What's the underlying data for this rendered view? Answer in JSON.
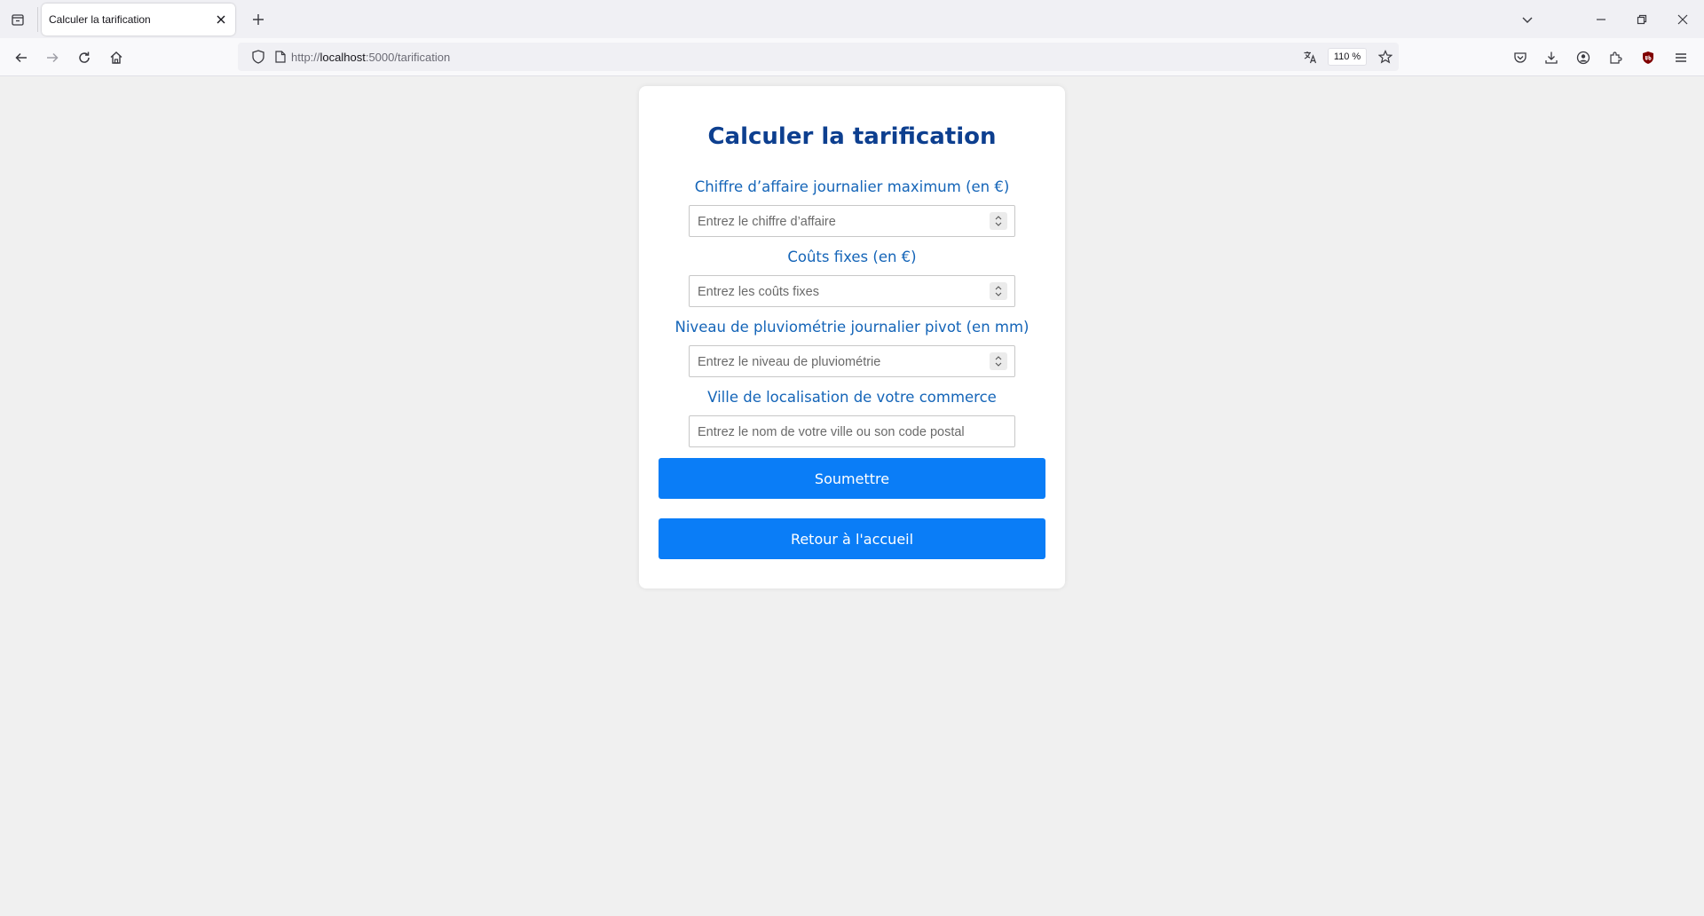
{
  "browser": {
    "tab_title": "Calculer la tarification",
    "url_scheme": "http://",
    "url_host": "localhost",
    "url_rest": ":5000/tarification",
    "zoom": "110 %"
  },
  "form": {
    "title": "Calculer la tarification",
    "fields": [
      {
        "label": "Chiffre d’affaire journalier maximum (en €)",
        "placeholder": "Entrez le chiffre d’affaire"
      },
      {
        "label": "Coûts fixes (en €)",
        "placeholder": "Entrez les coûts fixes"
      },
      {
        "label": "Niveau de pluviométrie journalier pivot (en mm)",
        "placeholder": "Entrez le niveau de pluviométrie"
      },
      {
        "label": "Ville de localisation de votre commerce",
        "placeholder": "Entrez le nom de votre ville ou son code postal"
      }
    ],
    "submit_label": "Soumettre",
    "home_label": "Retour à l'accueil"
  },
  "colors": {
    "accent": "#0a7df7",
    "title": "#0d3f8f",
    "label": "#1565b8",
    "page_bg": "#f0f0f0"
  }
}
